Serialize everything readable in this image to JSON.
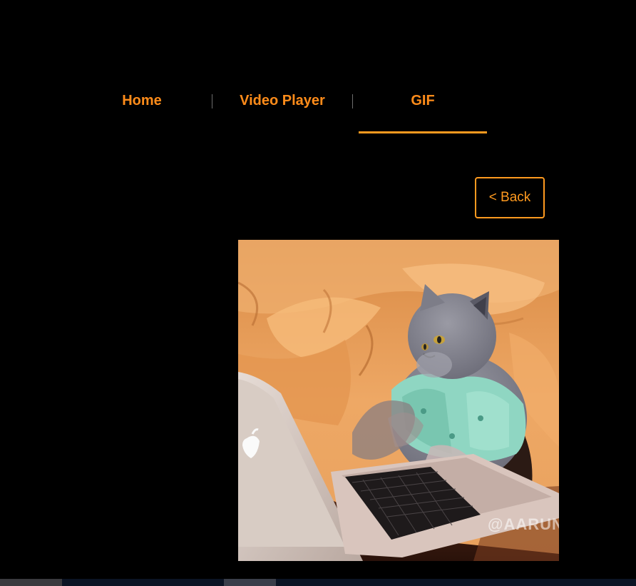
{
  "nav": {
    "items": [
      {
        "label": "Home"
      },
      {
        "label": "Video Player"
      },
      {
        "label": "GIF",
        "active": true
      }
    ],
    "accent_color": "#ff8c1a"
  },
  "back_button": {
    "label": "< Back"
  },
  "gif": {
    "watermark": "@AARUN"
  }
}
